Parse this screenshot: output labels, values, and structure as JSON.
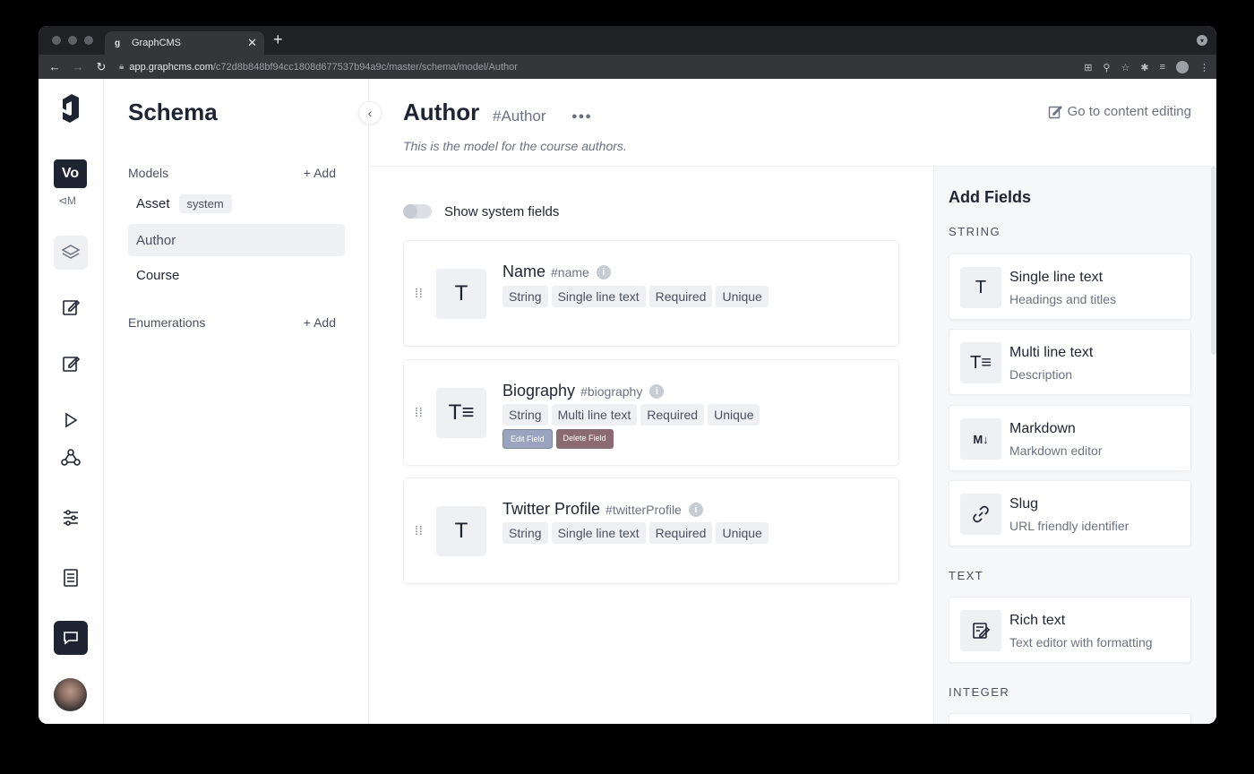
{
  "browser": {
    "tab_title": "GraphCMS",
    "url_host": "app.graphcms.com",
    "url_path": "/c72d8b848bf94cc1808d677537b94a9c/master/schema/model/Author"
  },
  "rail": {
    "project_initials": "Vo",
    "project_sub": "⊲M"
  },
  "sidebar": {
    "title": "Schema",
    "models_label": "Models",
    "add_label": "Add",
    "enumerations_label": "Enumerations",
    "models": [
      {
        "name": "Asset",
        "badge": "system"
      },
      {
        "name": "Author"
      },
      {
        "name": "Course"
      }
    ]
  },
  "main": {
    "title": "Author",
    "api_id": "#Author",
    "description": "This is the model for the course authors.",
    "goto": "Go to content editing",
    "toggle_label": "Show system fields",
    "fields": [
      {
        "name": "Name",
        "api": "#name",
        "tags": [
          "String",
          "Single line text",
          "Required",
          "Unique"
        ]
      },
      {
        "name": "Biography",
        "api": "#biography",
        "tags": [
          "String",
          "Multi line text",
          "Required",
          "Unique"
        ],
        "edit": "Edit Field",
        "delete": "Delete Field"
      },
      {
        "name": "Twitter Profile",
        "api": "#twitterProfile",
        "tags": [
          "String",
          "Single line text",
          "Required",
          "Unique"
        ]
      }
    ]
  },
  "panel": {
    "title": "Add Fields",
    "groups": {
      "string": "STRING",
      "text": "TEXT",
      "integer": "INTEGER"
    },
    "items": [
      {
        "title": "Single line text",
        "desc": "Headings and titles",
        "icon": "T"
      },
      {
        "title": "Multi line text",
        "desc": "Description",
        "icon": "T≡"
      },
      {
        "title": "Markdown",
        "desc": "Markdown editor",
        "icon": "M↓"
      },
      {
        "title": "Slug",
        "desc": "URL friendly identifier",
        "icon": "link-icon"
      },
      {
        "title": "Rich text",
        "desc": "Text editor with formatting",
        "icon": "rich-text-icon"
      }
    ]
  }
}
